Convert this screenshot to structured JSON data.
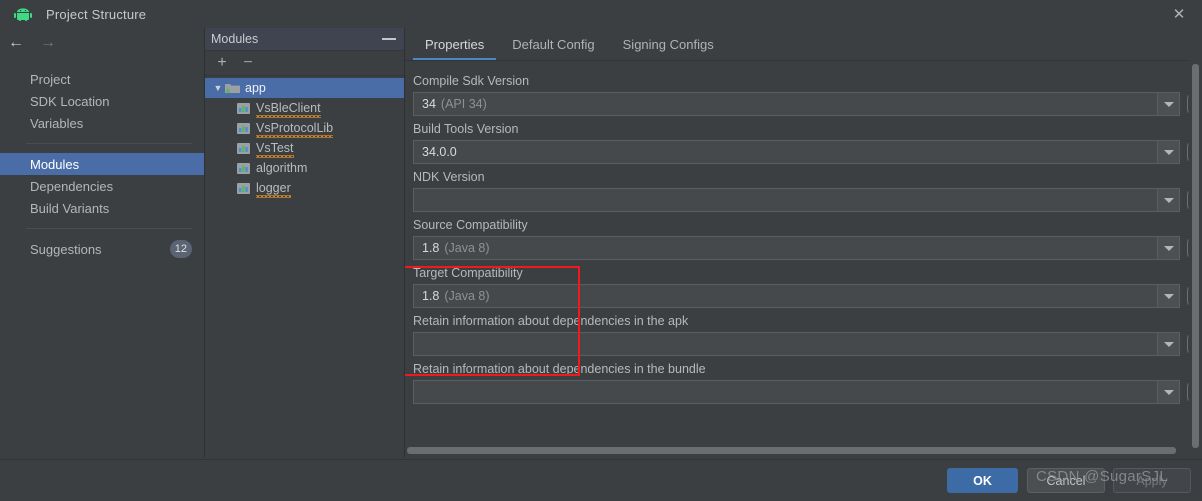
{
  "window": {
    "title": "Project Structure",
    "app_icon": "android-icon",
    "close_icon": "close-icon"
  },
  "nav": {
    "back_icon": "arrow-left-icon",
    "forward_icon": "arrow-right-icon",
    "items": [
      {
        "label": "Project",
        "selected": false
      },
      {
        "label": "SDK Location",
        "selected": false
      },
      {
        "label": "Variables",
        "selected": false
      },
      {
        "label": "Modules",
        "selected": true
      },
      {
        "label": "Dependencies",
        "selected": false
      },
      {
        "label": "Build Variants",
        "selected": false
      }
    ],
    "suggestions": {
      "label": "Suggestions",
      "badge": "12"
    }
  },
  "modules_panel": {
    "header_title": "Modules",
    "minimize_icon": "minimize-icon",
    "add_label": "+",
    "remove_label": "−",
    "tree": [
      {
        "label": "app",
        "level": 0,
        "icon": "folder-icon",
        "selected": true,
        "expanded": true,
        "squiggly": false
      },
      {
        "label": "VsBleClient",
        "level": 1,
        "icon": "module-icon",
        "selected": false,
        "squiggly": true
      },
      {
        "label": "VsProtocolLib",
        "level": 1,
        "icon": "module-icon",
        "selected": false,
        "squiggly": true
      },
      {
        "label": "VsTest",
        "level": 1,
        "icon": "module-icon",
        "selected": false,
        "squiggly": true
      },
      {
        "label": "algorithm",
        "level": 1,
        "icon": "module-icon",
        "selected": false,
        "squiggly": false
      },
      {
        "label": "logger",
        "level": 1,
        "icon": "module-icon",
        "selected": false,
        "squiggly": true
      }
    ]
  },
  "content": {
    "tabs": [
      {
        "label": "Properties",
        "active": true
      },
      {
        "label": "Default Config",
        "active": false
      },
      {
        "label": "Signing Configs",
        "active": false
      }
    ],
    "fields": [
      {
        "label": "Compile Sdk Version",
        "value": "34",
        "value_hint": "(API 34)"
      },
      {
        "label": "Build Tools Version",
        "value": "34.0.0",
        "value_hint": ""
      },
      {
        "label": "NDK Version",
        "value": "",
        "value_hint": ""
      },
      {
        "label": "Source Compatibility",
        "value": "1.8",
        "value_hint": "(Java 8)"
      },
      {
        "label": "Target Compatibility",
        "value": "1.8",
        "value_hint": "(Java 8)"
      },
      {
        "label": "Retain information about dependencies in the apk",
        "value": "",
        "value_hint": ""
      },
      {
        "label": "Retain information about dependencies in the bundle",
        "value": "",
        "value_hint": ""
      }
    ],
    "annotation": {
      "color": "#f0191b",
      "targets": [
        "Source Compatibility",
        "Target Compatibility"
      ]
    }
  },
  "footer": {
    "ok_label": "OK",
    "cancel_label": "Cancel",
    "apply_label": "Apply",
    "apply_enabled": false,
    "accent_color": "#3c6ba5"
  },
  "watermark": {
    "text": "CSDN @SugarSJL"
  }
}
